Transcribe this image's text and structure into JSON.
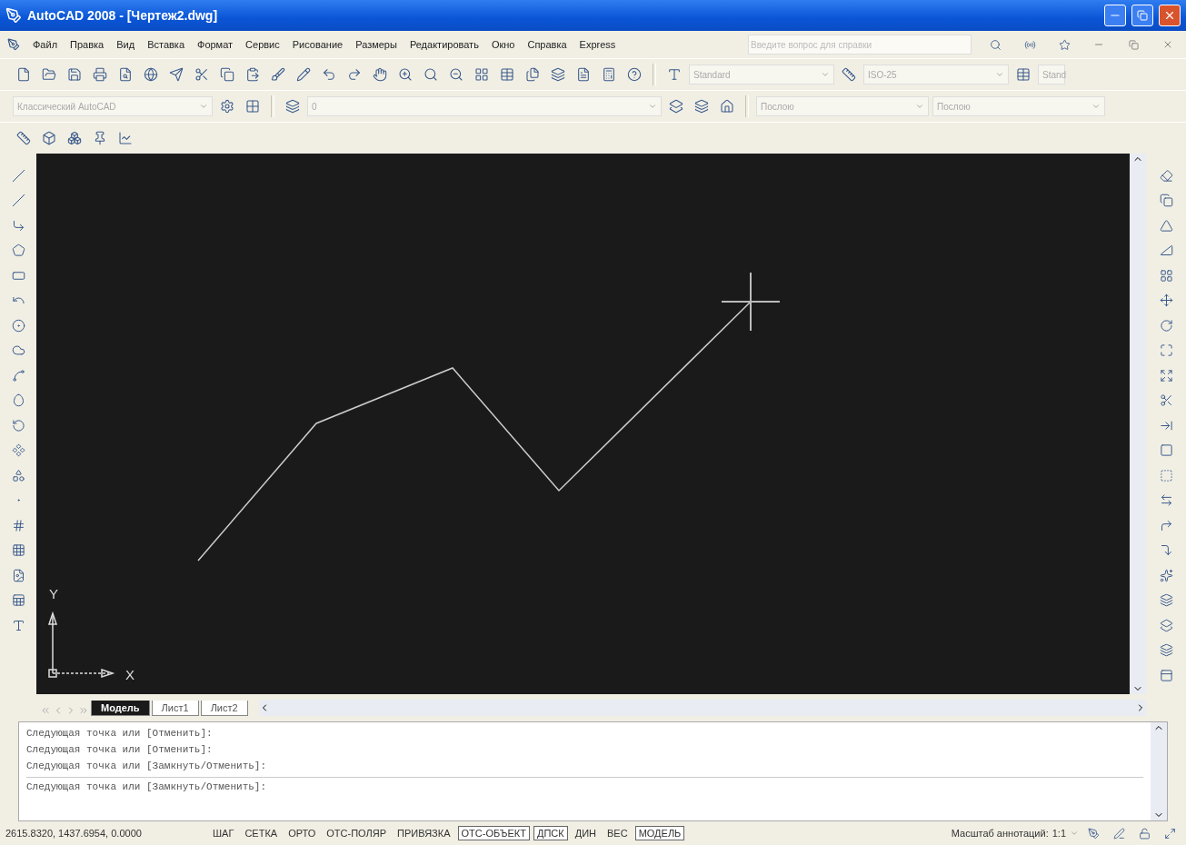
{
  "window": {
    "title": "AutoCAD 2008 - [Чертеж2.dwg]"
  },
  "menu": [
    "Файл",
    "Правка",
    "Вид",
    "Вставка",
    "Формат",
    "Сервис",
    "Рисование",
    "Размеры",
    "Редактировать",
    "Окно",
    "Справка",
    "Express"
  ],
  "help_search": {
    "placeholder": "Введите вопрос для справки"
  },
  "styles_toolbar": {
    "text_style": "Standard",
    "dim_style": "ISO-25",
    "table_style": "Stand"
  },
  "workspace": {
    "value": "Классический AutoCAD"
  },
  "layer": {
    "value": "0"
  },
  "properties": {
    "color_setting": "Послою",
    "linetype": "Послою"
  },
  "drawing": {
    "y_label": "Y",
    "x_label": "X"
  },
  "layout_tabs": [
    {
      "label": "Модель",
      "selected": true
    },
    {
      "label": "Лист1",
      "selected": false
    },
    {
      "label": "Лист2",
      "selected": false
    }
  ],
  "command_history": [
    "Следующая точка или [Отменить]:",
    "Следующая точка или [Отменить]:",
    "Следующая точка или [Замкнуть/Отменить]:"
  ],
  "command_line": "Следующая точка или [Замкнуть/Отменить]:",
  "status_bar": {
    "coordinates": "2615.8320, 1437.6954, 0.0000",
    "toggles": [
      {
        "label": "ШАГ",
        "on": false
      },
      {
        "label": "СЕТКА",
        "on": false
      },
      {
        "label": "ОРТО",
        "on": false
      },
      {
        "label": "ОТС-ПОЛЯР",
        "on": false
      },
      {
        "label": "ПРИВЯЗКА",
        "on": false
      },
      {
        "label": "ОТС-ОБЪЕКТ",
        "on": true
      },
      {
        "label": "ДПСК",
        "on": true
      },
      {
        "label": "ДИН",
        "on": false
      },
      {
        "label": "ВЕС",
        "on": false
      },
      {
        "label": "МОДЕЛЬ",
        "on": true
      }
    ],
    "annotation_scale_label": "Масштаб аннотаций:",
    "annotation_scale": "1:1"
  }
}
